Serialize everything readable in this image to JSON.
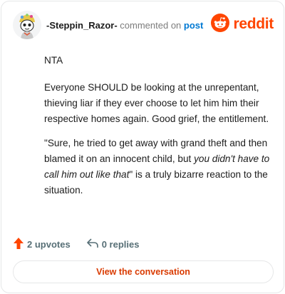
{
  "comment": {
    "username": "-Steppin_Razor-",
    "action_text": "commented on",
    "link_text": "post",
    "paragraphs": {
      "p1": "NTA",
      "p2": "Everyone SHOULD be looking at the unrepentant, thieving liar if they ever choose to let him him their respective homes again. Good grief, the entitlement.",
      "p3_start": "\"Sure, he tried to get away with grand theft and then blamed it on an innocent child, but ",
      "p3_italic": "you didn't have to call him out like that",
      "p3_end": "\" is a truly bizarre reaction to the situation."
    },
    "upvotes": "2 upvotes",
    "replies": "0 replies"
  },
  "brand": {
    "logo_text": "reddit",
    "color": "#ff4500"
  },
  "cta": {
    "label": "View the conversation"
  },
  "colors": {
    "upvote": "#ff4500",
    "link": "#0079d3",
    "cta_text": "#d93a00",
    "muted": "#576f76"
  },
  "icons": [
    "avatar",
    "reddit-logo-icon",
    "upvote-arrow-icon",
    "reply-arrow-icon"
  ]
}
